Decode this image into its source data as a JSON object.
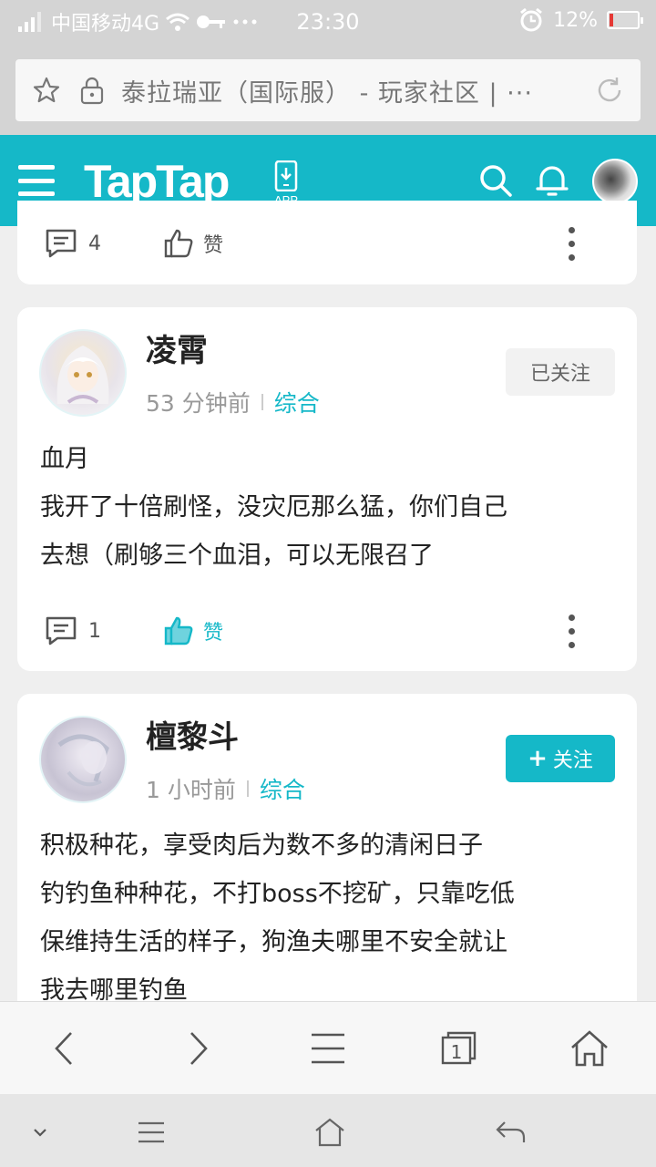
{
  "status_bar": {
    "carrier": "中国移动4G",
    "time": "23:30",
    "battery_percent": "12%",
    "battery_level": 0.12,
    "icons": [
      "signal-icon",
      "wifi-icon",
      "vpn-key-icon",
      "more-dots-icon",
      "alarm-icon",
      "battery-icon"
    ]
  },
  "browser": {
    "url_title": "泰拉瑞亚（国际服） - 玩家社区 | ···",
    "icons": [
      "star-icon",
      "lock-icon",
      "refresh-icon"
    ]
  },
  "header": {
    "logo": "TapTap",
    "app_label": "APP",
    "brand_color": "#15b8c8",
    "icons": [
      "menu-icon",
      "app-download-icon",
      "search-icon",
      "bell-icon",
      "avatar"
    ]
  },
  "posts": [
    {
      "comment_count": "4",
      "like_label": "赞",
      "liked": false
    },
    {
      "username": "凌霄",
      "time": "53 分钟前",
      "category": "综合",
      "follow_label": "已关注",
      "followed": true,
      "lines": [
        "血月",
        "我开了十倍刷怪，没灾厄那么猛，你们自己",
        "去想（刷够三个血泪，可以无限召了"
      ],
      "comment_count": "1",
      "like_label": "赞",
      "liked": true
    },
    {
      "username": "檀黎斗",
      "time": "1 小时前",
      "category": "综合",
      "follow_label": "关注",
      "follow_plus": "+",
      "followed": false,
      "lines": [
        "积极种花，享受肉后为数不多的清闲日子",
        "钓钓鱼种种花，不打boss不挖矿，只靠吃低",
        "保维持生活的样子，狗渔夫哪里不安全就让",
        "我去哪里钓鱼"
      ]
    }
  ],
  "browser_nav": {
    "tab_count": "1",
    "icons": [
      "back-icon",
      "forward-icon",
      "menu-lines-icon",
      "tabs-icon",
      "home-icon"
    ]
  },
  "system_nav": {
    "icons": [
      "chevron-down-icon",
      "menu-icon",
      "home-outline-icon",
      "return-icon"
    ]
  }
}
